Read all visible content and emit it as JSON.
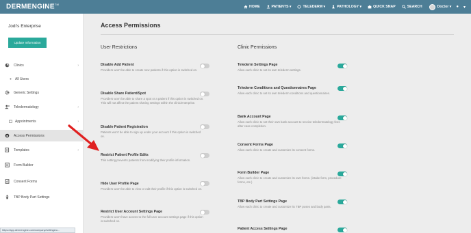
{
  "app": {
    "logo": "DERMENGINE",
    "logo_tm": "TM"
  },
  "nav": [
    {
      "label": "HOME",
      "icon": "home-icon"
    },
    {
      "label": "PATIENTS ▾",
      "icon": "user-icon"
    },
    {
      "label": "TELEDERM ▾",
      "icon": "telederm-icon"
    },
    {
      "label": "PATHOLOGY ▾",
      "icon": "pathology-icon"
    },
    {
      "label": "QUICK SNAP",
      "icon": "camera-icon"
    },
    {
      "label": "SEARCH",
      "icon": "search-icon"
    }
  ],
  "user": {
    "name": "Doctor ▾"
  },
  "sidebar": {
    "enterprise_name": "Jodi's Enterprise",
    "update_button": "Update Information",
    "items": [
      {
        "label": "Clinics",
        "icon": "clinic-icon",
        "chevron": "›"
      },
      {
        "label": "All Users",
        "icon": "users-icon",
        "chevron": ""
      },
      {
        "label": "Generic Settings",
        "icon": "gear-icon",
        "chevron": ""
      },
      {
        "label": "Teledermatology",
        "icon": "telederm-icon",
        "chevron": "›"
      },
      {
        "label": "Appointments",
        "icon": "calendar-icon",
        "chevron": "›"
      },
      {
        "label": "Access Permissions",
        "icon": "lock-icon",
        "chevron": ""
      },
      {
        "label": "Templates",
        "icon": "template-icon",
        "chevron": "›"
      },
      {
        "label": "Form Builder",
        "icon": "form-icon",
        "chevron": ""
      },
      {
        "label": "Consent Forms",
        "icon": "consent-icon",
        "chevron": ""
      },
      {
        "label": "TBP Body Part Settings",
        "icon": "body-icon",
        "chevron": ""
      }
    ]
  },
  "main": {
    "title": "Access Permissions",
    "user_restrictions": {
      "heading": "User Restrictions",
      "options": [
        {
          "title": "Disable Add Patient",
          "desc": "Providers won't be able to create new patients if this option is switched on.",
          "on": false
        },
        {
          "title": "Disable Share Patient/Spot",
          "desc": "Providers won't be able to share a spot or a patient if this option is switched on. This will not affect the patient sharing settings within the clinic/enterprise.",
          "on": false
        },
        {
          "title": "Disable Patient Registration",
          "desc": "Patients won't be able to sign up under your account if this option is switched on.",
          "on": false
        },
        {
          "title": "Restrict Patient Profile Edits",
          "desc": "This setting prevents patients from modifying their profile information.",
          "on": false
        },
        {
          "title": "Hide User Profile Page",
          "desc": "Providers won't be able to view or edit their profile if this option is switched on.",
          "on": false
        },
        {
          "title": "Restrict User Account Settings Page",
          "desc": "Providers won't have access to the full user account settings page if this option is switched on.",
          "on": false
        }
      ]
    },
    "clinic_permissions": {
      "heading": "Clinic Permissions",
      "options": [
        {
          "title": "Telederm Settings Page",
          "desc": "Allow each clinic to set its own telederm settings.",
          "on": true
        },
        {
          "title": "Telederm Conditions and Questionnaires Page",
          "desc": "Allow each clinic to set its own telederm conditions and questionnaires.",
          "on": true
        },
        {
          "title": "Bank Account Page",
          "desc": "Allow each clinic to set their own bank account to receive teledermatology fees after case completion.",
          "on": true
        },
        {
          "title": "Consent Forms Page",
          "desc": "Allow each clinic to create and customize its consent forms.",
          "on": true
        },
        {
          "title": "Form Builder Page",
          "desc": "Allow each clinic to create and customize its own forms. (intake form, procedure forms, etc.)",
          "on": true
        },
        {
          "title": "TBP Body Part Settings Page",
          "desc": "Allow each clinic to create and customize its TBP poses and body parts.",
          "on": true
        },
        {
          "title": "Patient Access Settings Page",
          "desc": "",
          "on": true
        }
      ]
    }
  },
  "statusbar": {
    "url": "https://app.dermengine.com/company/settings/u..."
  },
  "colors": {
    "topbar": "#4d7e96",
    "accent": "#2aa99b",
    "arrow": "#e02020"
  }
}
